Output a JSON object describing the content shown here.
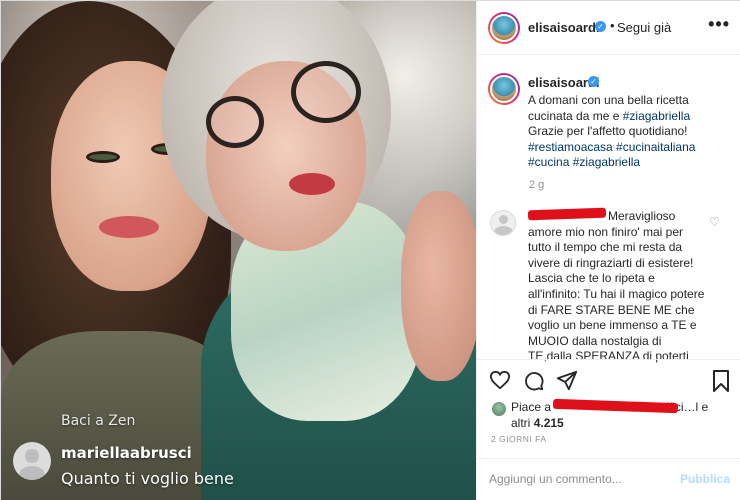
{
  "post": {
    "username": "elisaisoardi",
    "follow_status": "Segui già",
    "more_glyph": "•••",
    "separator": "•"
  },
  "media_overlay": {
    "baci_text": "Baci a Zen",
    "commenter": "mariellaabrusci",
    "comment": "Quanto ti voglio bene"
  },
  "caption": {
    "username": "elisaisoardi",
    "text_1": "A domani con una bella ricetta cucinata da me e ",
    "tag_1": "#ziagabriella",
    "text_2": " Grazie per l'affetto quotidiano!",
    "tags_line": "#restiamoacasa #cucinaitaliana #cucina #ziagabriella",
    "age": "2 g"
  },
  "comment": {
    "text": "Meraviglioso amore mio non finiro' mai per tutto il tempo che mi resta da vivere di ringraziarti di esistere! Lascia che te lo ripeta e all'infinito: Tu hai il magico potere di FARE STARE BENE ME che voglio un bene immenso a TE e MUOIO dalla nostalgia di TE,dalla SPERANZA di poterti",
    "like_icon": "heart-outline-icon"
  },
  "actions": {
    "like": "♡",
    "comment": "◯",
    "share": "➢",
    "save": "🔖"
  },
  "likes": {
    "prefix": "Piace a",
    "suffix": "ffici…l e",
    "others_label": "altri",
    "count": "4.215"
  },
  "date": "2 GIORNI FA",
  "add_comment": {
    "placeholder": "Aggiungi un commento...",
    "publish_label": "Pubblica"
  },
  "colors": {
    "verified": "#3897f0",
    "hashtag": "#00376b",
    "publish_disabled": "#b2dffc",
    "redaction": "#e0101b"
  }
}
